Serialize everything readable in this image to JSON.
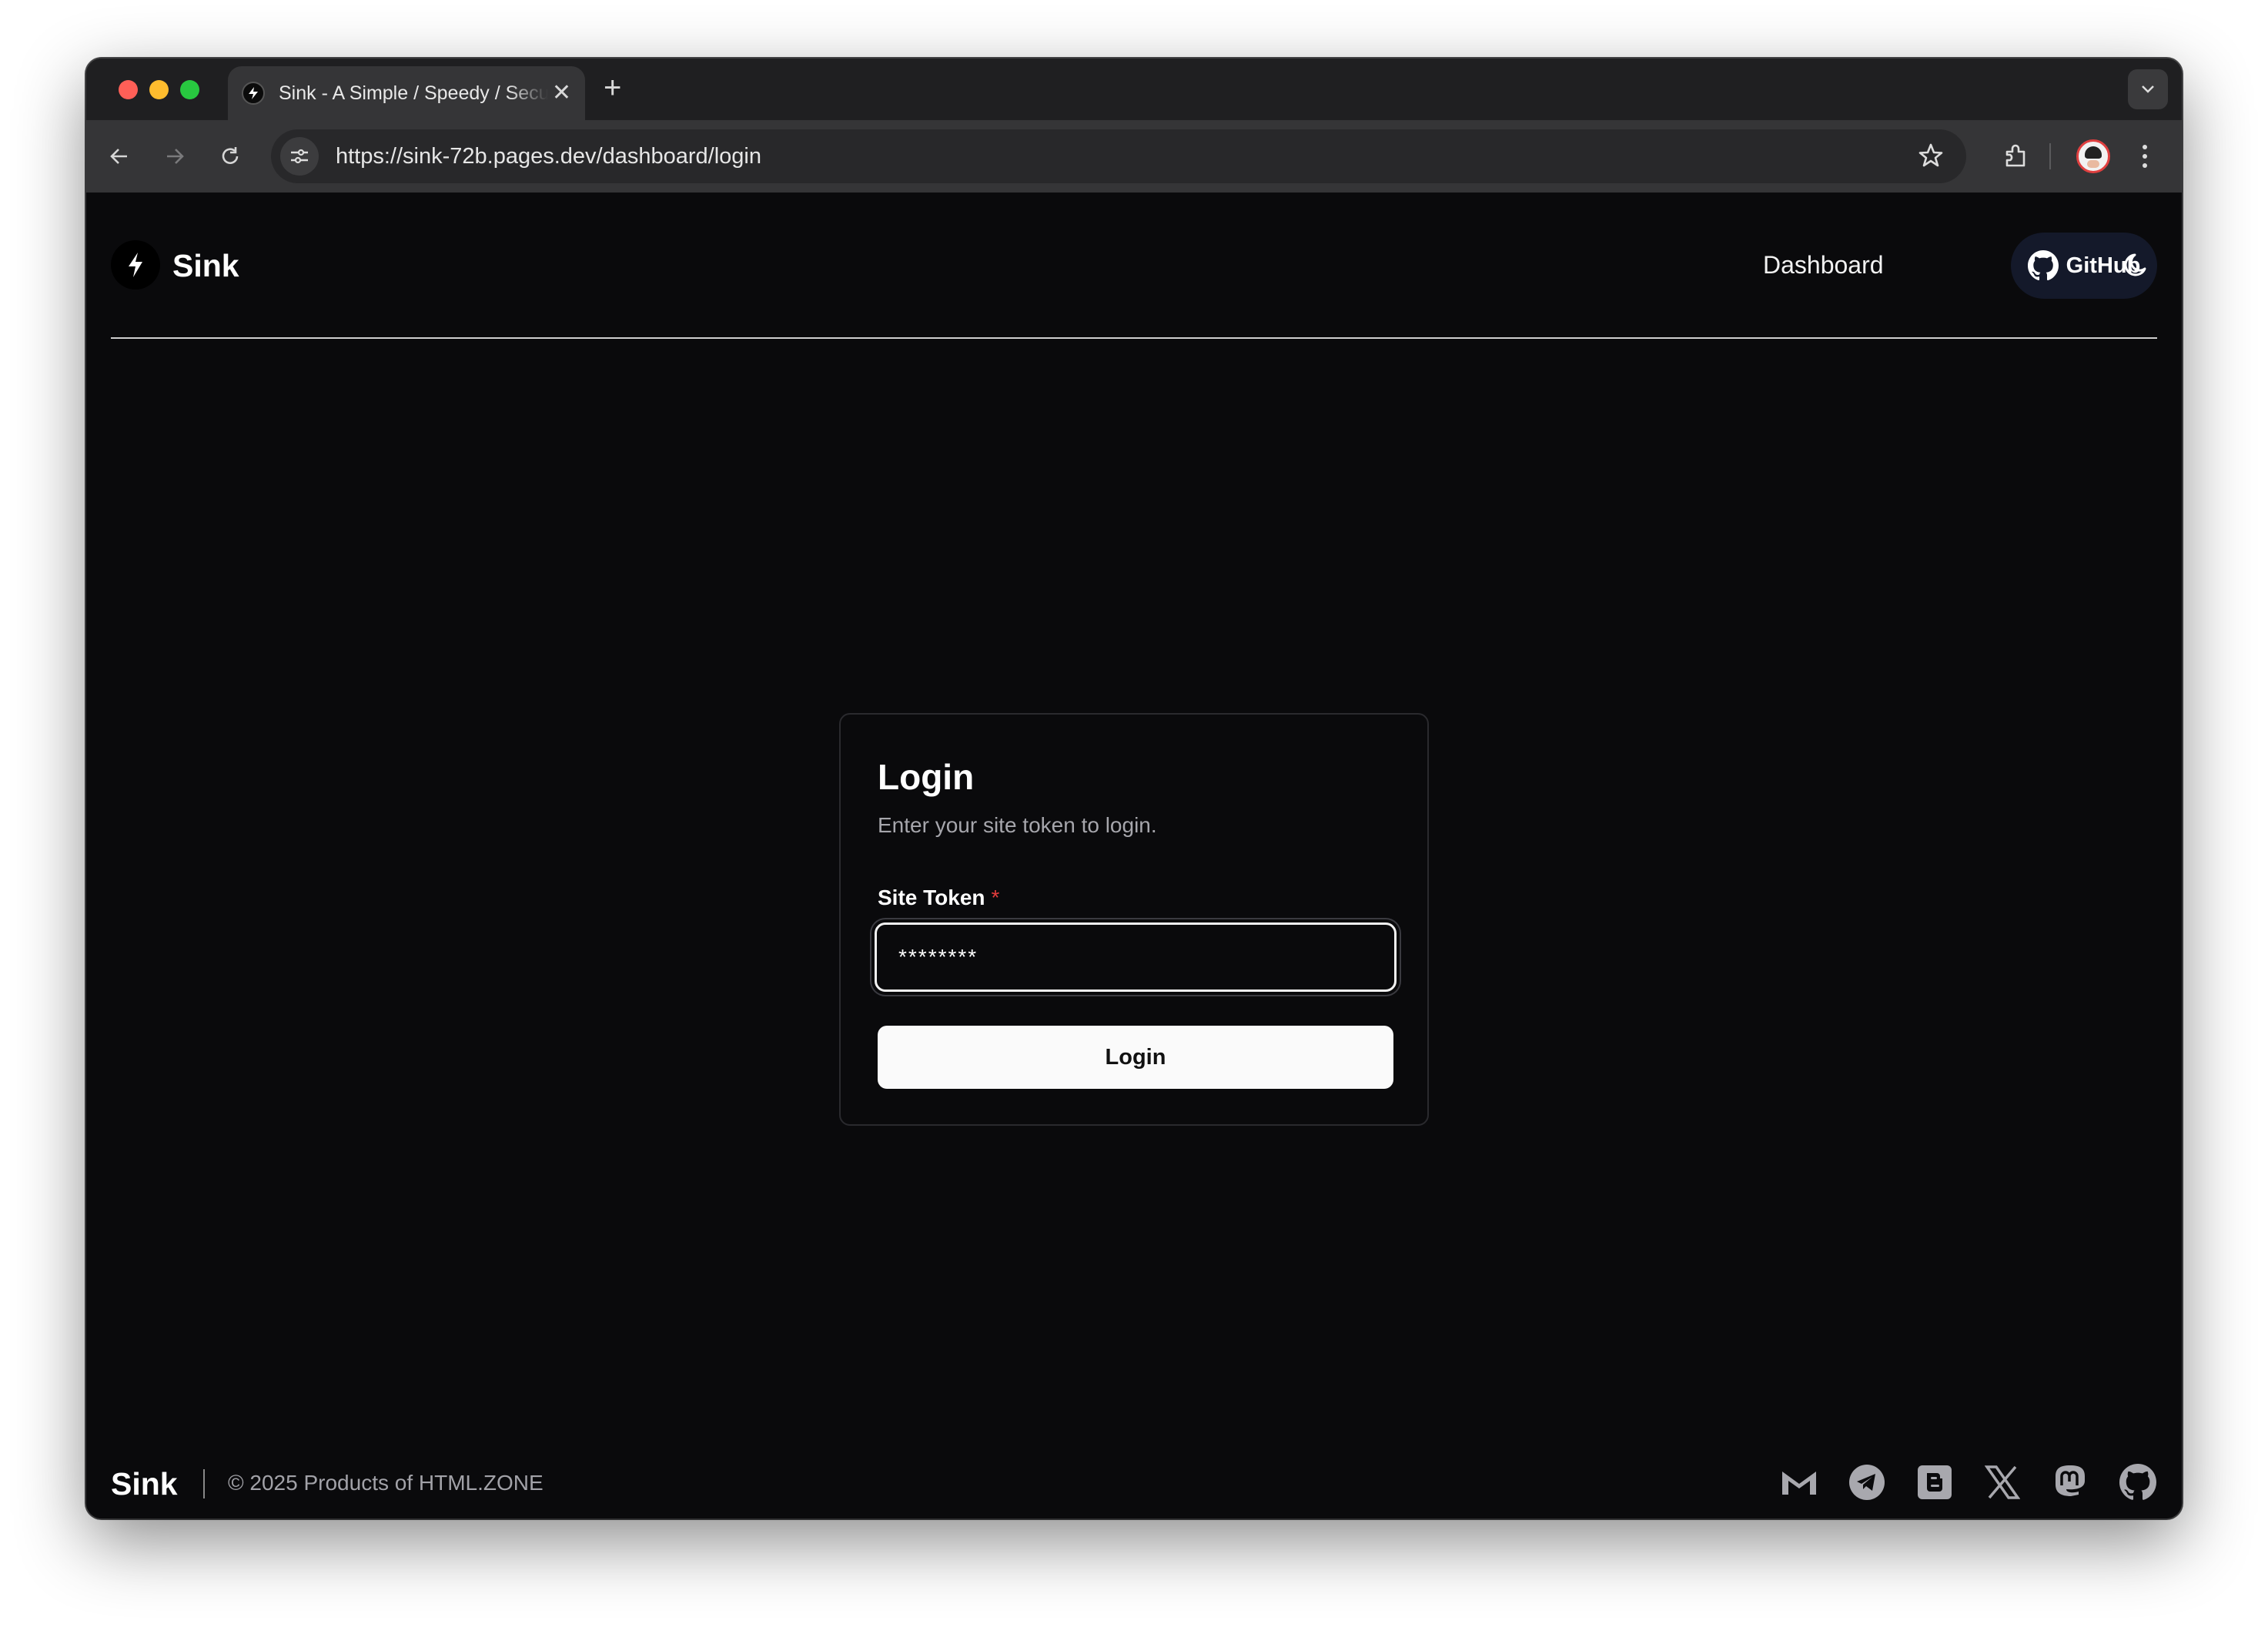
{
  "browser": {
    "tab_title": "Sink - A Simple / Speedy / Secure Link Shortener",
    "tab_close": "✕",
    "new_tab": "+",
    "url": "https://sink-72b.pages.dev/dashboard/login"
  },
  "header": {
    "brand": "Sink",
    "nav_dashboard": "Dashboard",
    "github_label": "GitHub"
  },
  "login": {
    "title": "Login",
    "description": "Enter your site token to login.",
    "field_label": "Site Token",
    "required_mark": "*",
    "token_value": "********",
    "button_label": "Login"
  },
  "footer": {
    "brand": "Sink",
    "copyright": "© 2025 Products of HTML.ZONE",
    "socials": [
      "gmail-icon",
      "telegram-icon",
      "blogger-icon",
      "x-icon",
      "mastodon-icon",
      "github-icon"
    ]
  },
  "colors": {
    "page_bg": "#0a0a0c",
    "accent_github_btn": "#14192a",
    "required": "#e23c3c"
  }
}
